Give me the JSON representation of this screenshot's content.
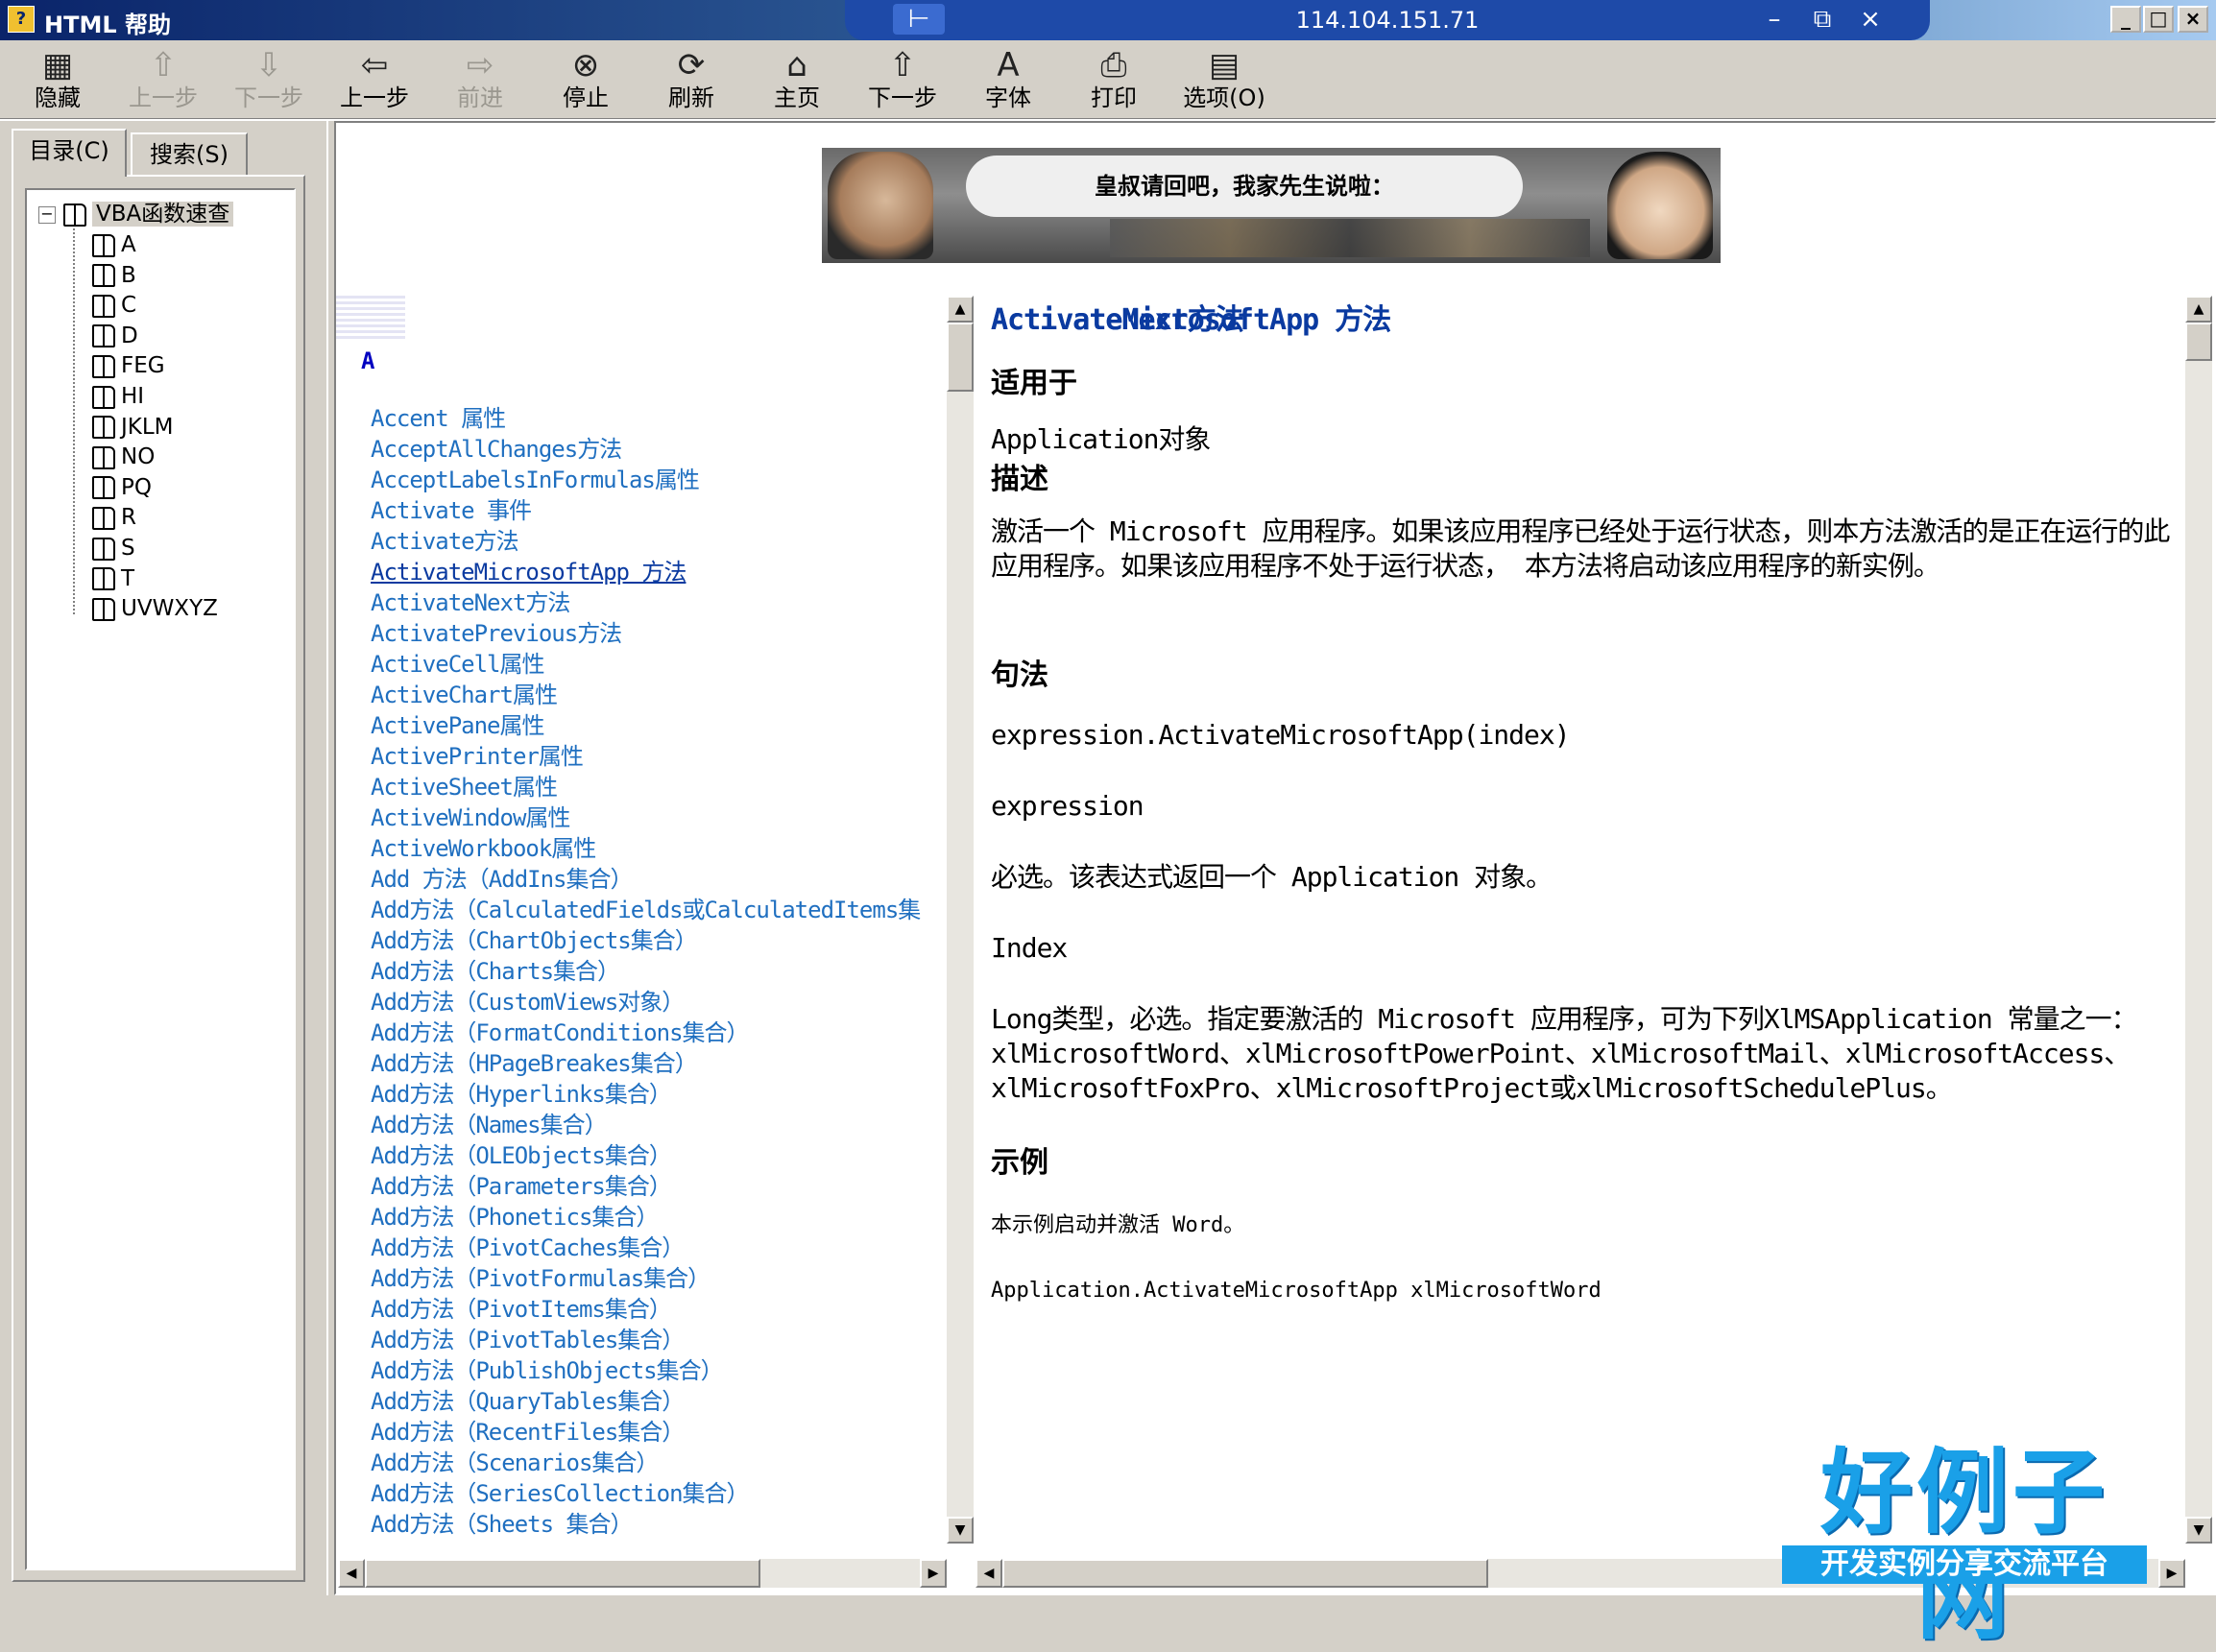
{
  "window": {
    "title": "HTML 帮助",
    "remote_host": "114.104.151.71",
    "rdp_pin_glyph": "⊢",
    "rdp_minimize": "–",
    "rdp_restore": "⧉",
    "rdp_close": "×",
    "minimize": "_",
    "maximize": "□",
    "close": "×"
  },
  "toolbar": {
    "buttons": [
      {
        "label": "隐藏",
        "icon": "hide-icon",
        "glyph": "▦",
        "enabled": true
      },
      {
        "label": "上一步",
        "icon": "up-arrow-icon",
        "glyph": "⇧",
        "enabled": false
      },
      {
        "label": "下一步",
        "icon": "down-arrow-icon",
        "glyph": "⇩",
        "enabled": false
      },
      {
        "label": "上一步",
        "icon": "back-arrow-icon",
        "glyph": "⇦",
        "enabled": true
      },
      {
        "label": "前进",
        "icon": "forward-arrow-icon",
        "glyph": "⇨",
        "enabled": false
      },
      {
        "label": "停止",
        "icon": "stop-icon",
        "glyph": "⊗",
        "enabled": true
      },
      {
        "label": "刷新",
        "icon": "refresh-icon",
        "glyph": "⟳",
        "enabled": true
      },
      {
        "label": "主页",
        "icon": "home-icon",
        "glyph": "⌂",
        "enabled": true
      },
      {
        "label": "下一步",
        "icon": "up-next-icon",
        "glyph": "⇧",
        "enabled": true
      },
      {
        "label": "字体",
        "icon": "font-icon",
        "glyph": "A",
        "enabled": true
      },
      {
        "label": "打印",
        "icon": "print-icon",
        "glyph": "⎙",
        "enabled": true
      },
      {
        "label": "选项(O)",
        "icon": "options-icon",
        "glyph": "▤",
        "enabled": true
      }
    ]
  },
  "nav": {
    "tabs": [
      "目录(C)",
      "搜索(S)"
    ],
    "tree": {
      "root": "VBA函数速查",
      "items": [
        "A",
        "B",
        "C",
        "D",
        "FEG",
        "HI",
        "JKLM",
        "NO",
        "PQ",
        "R",
        "S",
        "T",
        "UVWXYZ"
      ]
    }
  },
  "banner": {
    "speech": "皇叔请回吧，我家先生说啦："
  },
  "index": {
    "letter": "A",
    "items": [
      "Accent 属性",
      "AcceptAllChanges方法",
      "AcceptLabelsInFormulas属性",
      "Activate 事件",
      "Activate方法",
      "ActivateMicrosoftApp 方法",
      "ActivateNext方法",
      "ActivatePrevious方法",
      "ActiveCell属性",
      "ActiveChart属性",
      "ActivePane属性",
      "ActivePrinter属性",
      "ActiveSheet属性",
      "ActiveWindow属性",
      "ActiveWorkbook属性",
      "Add 方法（AddIns集合）",
      "Add方法（CalculatedFields或CalculatedItems集",
      "Add方法（ChartObjects集合）",
      "Add方法（Charts集合）",
      "Add方法（CustomViews对象）",
      "Add方法（FormatConditions集合）",
      "Add方法（HPageBreakes集合）",
      "Add方法（Hyperlinks集合）",
      "Add方法（Names集合）",
      "Add方法（OLEObjects集合）",
      "Add方法（Parameters集合）",
      "Add方法（Phonetics集合）",
      "Add方法（PivotCaches集合）",
      "Add方法（PivotFormulas集合）",
      "Add方法（PivotItems集合）",
      "Add方法（PivotTables集合）",
      "Add方法（PublishObjects集合）",
      "Add方法（QuaryTables集合）",
      "Add方法（RecentFiles集合）",
      "Add方法（Scenarios集合）",
      "Add方法（SeriesCollection集合）",
      "Add方法（Sheets 集合）"
    ],
    "current_index": 5
  },
  "topic": {
    "title": "ActivateMicrosoftApp 方法",
    "applies_heading": "适用于",
    "applies_text": "Application对象",
    "desc_heading": "描述",
    "desc_text": "激活一个 Microsoft 应用程序。如果该应用程序已经处于运行状态，则本方法激活的是正在运行的此应用程序。如果该应用程序不处于运行状态， 本方法将启动该应用程序的新实例。",
    "syntax_heading": "句法",
    "syntax_text": "expression.ActivateMicrosoftApp(index)",
    "param1_name": "expression",
    "param1_desc": "必选。该表达式返回一个 Application 对象。",
    "param2_name": "Index",
    "param2_desc": "Long类型，必选。指定要激活的 Microsoft 应用程序，可为下列XlMSApplication 常量之一：xlMicrosoftWord、xlMicrosoftPowerPoint、xlMicrosoftMail、xlMicrosoftAccess、xlMicrosoftFoxPro、xlMicrosoftProject或xlMicrosoftSchedulePlus。",
    "example_heading": "示例",
    "example_text": "本示例启动并激活 Word。",
    "example_code": "Application.ActivateMicrosoftApp xlMicrosoftWord",
    "next_title": "ActivateNext方法"
  },
  "watermark": {
    "logo": "好例子网",
    "tagline": "开发实例分享交流平台"
  }
}
